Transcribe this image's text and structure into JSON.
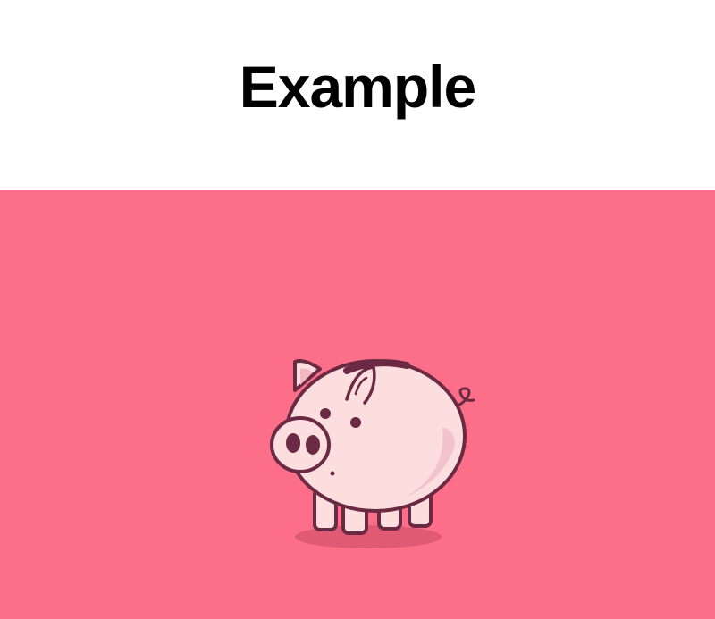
{
  "header": {
    "title": "Example"
  },
  "stage": {
    "background_color": "#fd6f88",
    "illustration": "piggy-bank-icon"
  },
  "colors": {
    "pig_fill": "#fcdede",
    "pig_outline": "#6a2a43",
    "shadow": "#e05a73"
  }
}
